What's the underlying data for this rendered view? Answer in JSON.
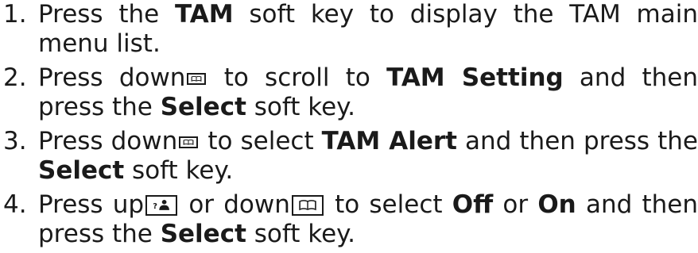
{
  "steps": [
    {
      "number": "1.",
      "parts": [
        "Press the ",
        "TAM",
        " soft key to display the TAM main menu list."
      ]
    },
    {
      "number": "2.",
      "parts": [
        "Press down",
        " to scroll to ",
        "TAM Setting",
        " and then press the ",
        "Select",
        " soft key."
      ]
    },
    {
      "number": "3.",
      "parts": [
        "Press down",
        " to select ",
        "TAM Alert",
        " and then press the ",
        "Select",
        " soft key."
      ]
    },
    {
      "number": "4.",
      "parts": [
        "Press up",
        " or down",
        " to select ",
        "Off",
        " or ",
        "On",
        " and then press the ",
        "Select",
        " soft key."
      ]
    }
  ],
  "icons": {
    "down_key": "phonebook-book-icon",
    "up_key": "caller-id-person-icon"
  }
}
